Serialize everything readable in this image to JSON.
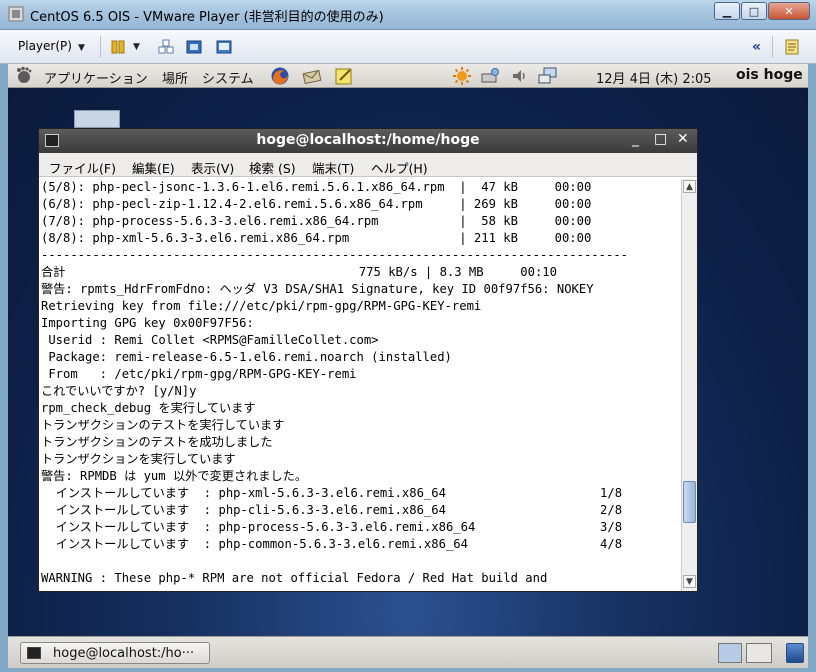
{
  "host": {
    "title": "CentOS 6.5 OIS - VMware Player (非営利目的の使用のみ)",
    "minimize": "▁",
    "maximize": "□",
    "close": "✕",
    "player_menu": "Player(P)",
    "caret": "▼",
    "collapse": "«"
  },
  "panel": {
    "menus": [
      "アプリケーション",
      "場所",
      "システム"
    ],
    "clock": "12月 4日 (木)  2:05",
    "user": "ois hoge"
  },
  "terminal": {
    "title": "hoge@localhost:/home/hoge",
    "controls": {
      "minimize": "_",
      "maximize": "□",
      "close": "✕"
    },
    "menus": [
      "ファイル(F)",
      "編集(E)",
      "表示(V)",
      "検索 (S)",
      "端末(T)",
      "ヘルプ(H)"
    ],
    "lines": [
      "(5/8): php-pecl-jsonc-1.3.6-1.el6.remi.5.6.1.x86_64.rpm  |  47 kB     00:00",
      "(6/8): php-pecl-zip-1.12.4-2.el6.remi.5.6.x86_64.rpm     | 269 kB     00:00",
      "(7/8): php-process-5.6.3-3.el6.remi.x86_64.rpm           |  58 kB     00:00",
      "(8/8): php-xml-5.6.3-3.el6.remi.x86_64.rpm               | 211 kB     00:00",
      "--------------------------------------------------------------------------------",
      "合計                                        775 kB/s | 8.3 MB     00:10",
      "警告: rpmts_HdrFromFdno: ヘッダ V3 DSA/SHA1 Signature, key ID 00f97f56: NOKEY",
      "Retrieving key from file:///etc/pki/rpm-gpg/RPM-GPG-KEY-remi",
      "Importing GPG key 0x00F97F56:",
      " Userid : Remi Collet <RPMS@FamilleCollet.com>",
      " Package: remi-release-6.5-1.el6.remi.noarch (installed)",
      " From   : /etc/pki/rpm-gpg/RPM-GPG-KEY-remi",
      "これでいいですか? [y/N]y",
      "rpm_check_debug を実行しています",
      "トランザクションのテストを実行しています",
      "トランザクションのテストを成功しました",
      "トランザクションを実行しています",
      "警告: RPMDB は yum 以外で変更されました。",
      "  インストールしています  : php-xml-5.6.3-3.el6.remi.x86_64                     1/8",
      "  インストールしています  : php-cli-5.6.3-3.el6.remi.x86_64                     2/8",
      "  インストールしています  : php-process-5.6.3-3.el6.remi.x86_64                 3/8",
      "  インストールしています  : php-common-5.6.3-3.el6.remi.x86_64                  4/8",
      "",
      "WARNING : These php-* RPM are not official Fedora / Red Hat build and"
    ],
    "scroll_up": "▲",
    "scroll_down": "▼"
  },
  "taskbar": {
    "task_label": "hoge@localhost:/ho···"
  }
}
